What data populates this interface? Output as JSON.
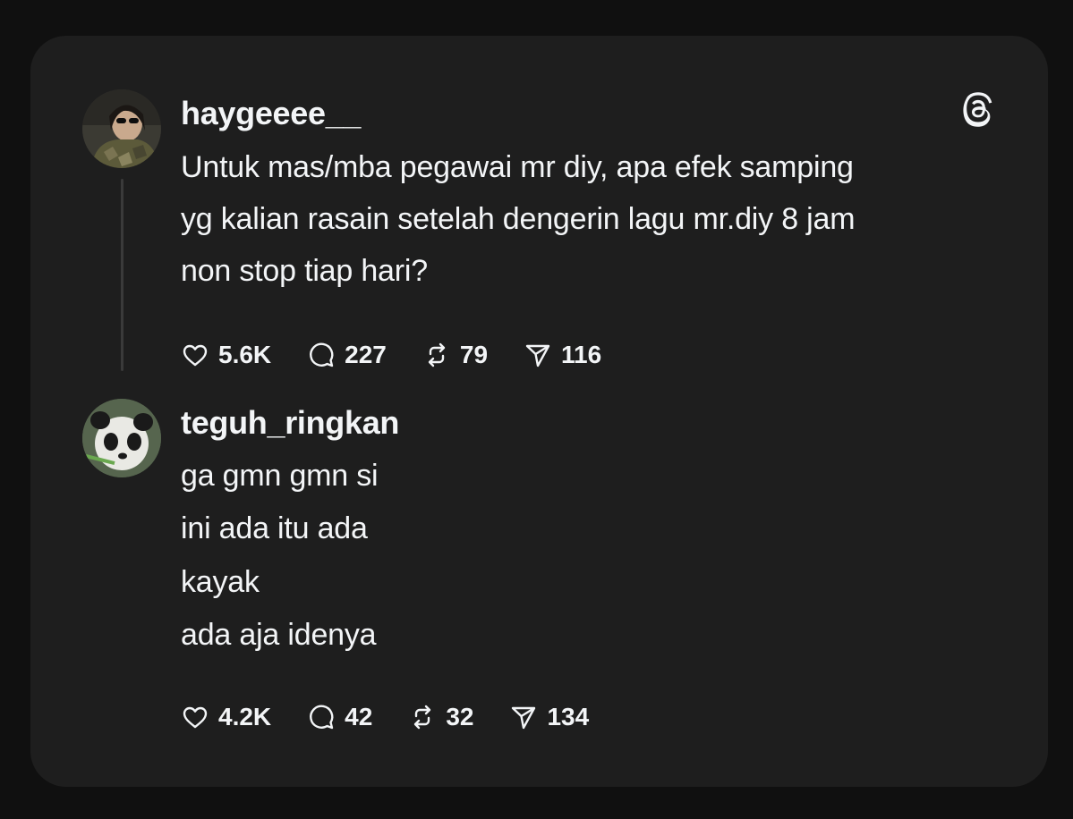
{
  "posts": [
    {
      "username": "haygeeee__",
      "lines": [
        "Untuk mas/mba pegawai mr diy, apa efek samping",
        "yg kalian rasain setelah dengerin lagu mr.diy 8 jam",
        "non stop tiap hari?"
      ],
      "likes": "5.6K",
      "replies": "227",
      "reposts": "79",
      "shares": "116"
    },
    {
      "username": "teguh_ringkan",
      "lines": [
        "ga gmn gmn si",
        "ini ada itu ada",
        "kayak",
        "ada aja idenya"
      ],
      "likes": "4.2K",
      "replies": "42",
      "reposts": "32",
      "shares": "134"
    }
  ],
  "icons": {
    "like": "heart-icon",
    "reply": "comment-icon",
    "repost": "repost-icon",
    "share": "share-icon",
    "brand": "threads-logo-icon"
  },
  "colors": {
    "background": "#101010",
    "card": "#1e1e1e",
    "text": "#f3f5f7",
    "thread_line": "#3a3a3a"
  }
}
